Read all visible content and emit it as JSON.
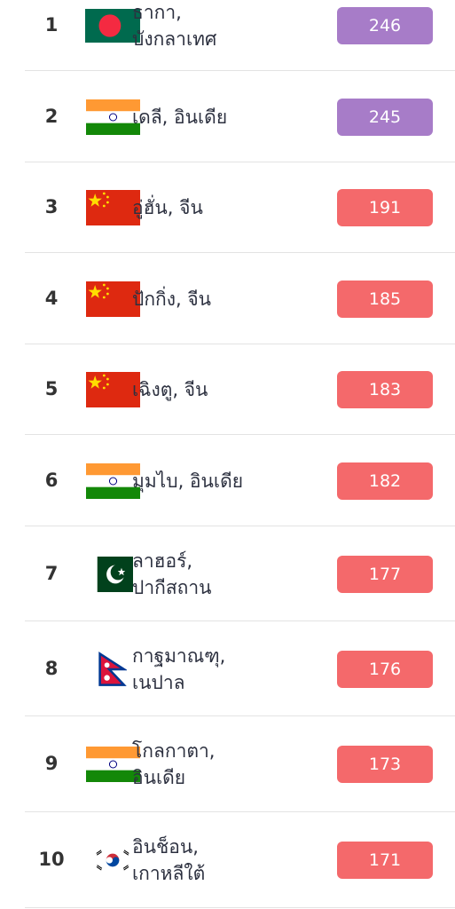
{
  "colors": {
    "very_unhealthy": "#a77cc8",
    "unhealthy": "#f4696b",
    "divider": "#e3e3e3",
    "text": "#2d3140"
  },
  "rankings": [
    {
      "rank": "1",
      "city_line1": "ธากา,",
      "city_line2": "บังกลาเทศ",
      "flag": "bangladesh-flag-icon",
      "aqi": "246",
      "level": "very_unhealthy"
    },
    {
      "rank": "2",
      "city_line1": "เดลี, อินเดีย",
      "city_line2": "",
      "flag": "india-flag-icon",
      "aqi": "245",
      "level": "very_unhealthy"
    },
    {
      "rank": "3",
      "city_line1": "อู่ฮั่น, จีน",
      "city_line2": "",
      "flag": "china-flag-icon",
      "aqi": "191",
      "level": "unhealthy"
    },
    {
      "rank": "4",
      "city_line1": "ปักกิ่ง, จีน",
      "city_line2": "",
      "flag": "china-flag-icon",
      "aqi": "185",
      "level": "unhealthy"
    },
    {
      "rank": "5",
      "city_line1": "เฉิงตู, จีน",
      "city_line2": "",
      "flag": "china-flag-icon",
      "aqi": "183",
      "level": "unhealthy"
    },
    {
      "rank": "6",
      "city_line1": "มุมไบ, อินเดีย",
      "city_line2": "",
      "flag": "india-flag-icon",
      "aqi": "182",
      "level": "unhealthy"
    },
    {
      "rank": "7",
      "city_line1": "ลาฮอร์,",
      "city_line2": "ปากีสถาน",
      "flag": "pakistan-flag-icon",
      "aqi": "177",
      "level": "unhealthy"
    },
    {
      "rank": "8",
      "city_line1": "กาฐมาณฑุ,",
      "city_line2": "เนปาล",
      "flag": "nepal-flag-icon",
      "aqi": "176",
      "level": "unhealthy"
    },
    {
      "rank": "9",
      "city_line1": "โกลกาตา,",
      "city_line2": "อินเดีย",
      "flag": "india-flag-icon",
      "aqi": "173",
      "level": "unhealthy"
    },
    {
      "rank": "10",
      "city_line1": "อินช็อน,",
      "city_line2": "เกาหลีใต้",
      "flag": "south-korea-flag-icon",
      "aqi": "171",
      "level": "unhealthy"
    }
  ]
}
